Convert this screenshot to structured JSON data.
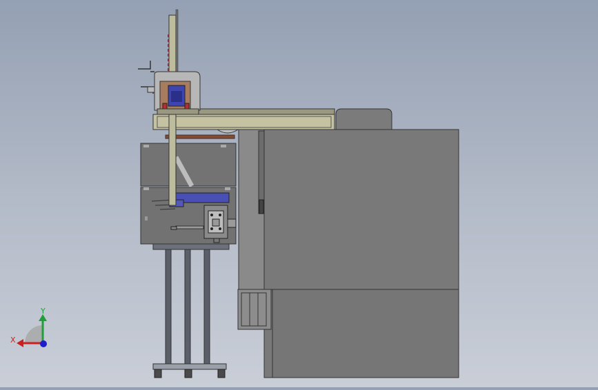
{
  "view": {
    "triad": {
      "x_label": "X",
      "y_label": "Y",
      "x_color": "#cc1f1f",
      "y_color": "#1f9e3a",
      "z_color": "#1d1dc9"
    },
    "colors": {
      "background_top": "#94a0b3",
      "background_bottom": "#c9ced7",
      "cabinet": "#7a7a7a",
      "cabinet_panel": "#6d6d6d",
      "frame": "#c7c4a4",
      "column": "#bfbfa0",
      "accent_blue": "#4a4fb4",
      "accent_brown": "#8b4a2b",
      "legs": "#5a5f6a"
    }
  }
}
